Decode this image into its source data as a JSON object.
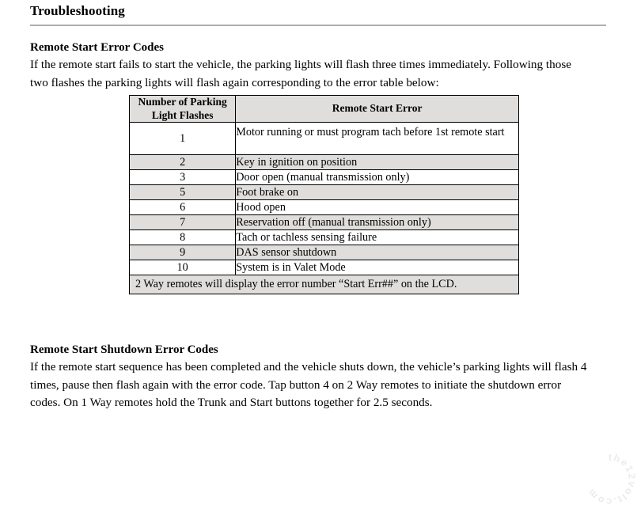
{
  "document": {
    "title": "Troubleshooting"
  },
  "sections": [
    {
      "heading": "Remote Start Error Codes",
      "paragraph": "If the remote start fails to start the vehicle, the parking lights will flash three times immediately. Following those two flashes the parking lights will flash again corresponding to the error table below:"
    },
    {
      "heading": "Remote Start Shutdown Error Codes",
      "paragraph": "If the remote start sequence has been completed and the vehicle shuts down, the vehicle’s parking lights will flash 4 times, pause then flash again with the error code. Tap button 4 on 2 Way remotes to initiate the shutdown error codes. On 1 Way remotes hold the Trunk and Start buttons together for 2.5 seconds."
    }
  ],
  "error_table": {
    "headers": {
      "flashes": "Number of Parking Light Flashes",
      "error": "Remote Start Error"
    },
    "rows": [
      {
        "flashes": "1",
        "error": "Motor running or must program tach before 1st remote start"
      },
      {
        "flashes": "2",
        "error": "Key in ignition on position"
      },
      {
        "flashes": "3",
        "error": "Door open (manual transmission only)"
      },
      {
        "flashes": "5",
        "error": "Foot brake on"
      },
      {
        "flashes": "6",
        "error": "Hood open"
      },
      {
        "flashes": "7",
        "error": "Reservation off (manual transmission only)"
      },
      {
        "flashes": "8",
        "error": "Tach or tachless sensing failure"
      },
      {
        "flashes": "9",
        "error": "DAS sensor shutdown"
      },
      {
        "flashes": "10",
        "error": "System is in Valet Mode"
      }
    ],
    "footnote": "2 Way remotes will display the error number “Start Err##” on the LCD."
  },
  "watermark": {
    "text": "the12volt.com"
  },
  "colors": {
    "page_background": "#ffffff",
    "text": "#000000",
    "table_border": "#000000",
    "row_shaded": "#e0dedc",
    "row_plain": "#ffffff",
    "header_shaded": "#e0dedc",
    "title_rule": "#adadad"
  }
}
